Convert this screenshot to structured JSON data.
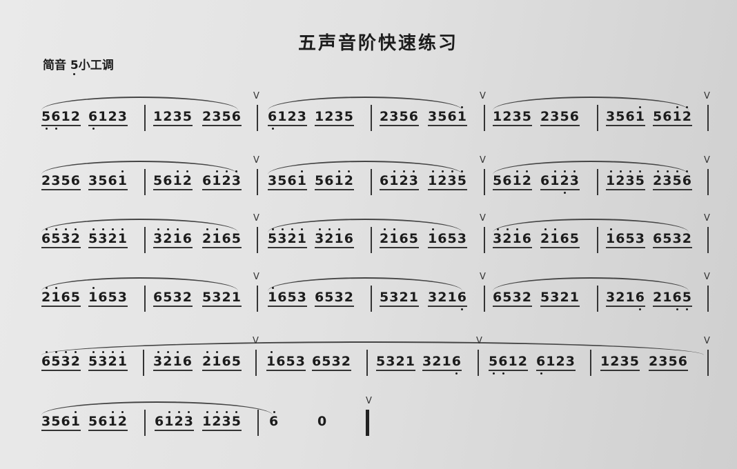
{
  "title": "五声音阶快速练习",
  "key_prefix": "简音 ",
  "key_note": "5",
  "key_suffix": "小工调",
  "rows": [
    {
      "measures": [
        [
          "5612",
          "6123"
        ],
        [
          "1235",
          "2356"
        ],
        [
          "6123",
          "1235"
        ],
        [
          "2356",
          "3561"
        ],
        [
          "1235",
          "2356"
        ],
        [
          "3561",
          "5612"
        ]
      ],
      "hi": [
        [
          [],
          []
        ],
        [
          [],
          []
        ],
        [
          [],
          []
        ],
        [
          [],
          [
            3
          ]
        ],
        [
          [],
          []
        ],
        [
          [
            3
          ],
          [
            2,
            3
          ]
        ]
      ],
      "lo": [
        [
          [
            0,
            1
          ],
          [
            0
          ]
        ],
        [
          [],
          []
        ],
        [
          [
            0
          ],
          []
        ],
        [
          [],
          []
        ],
        [
          [],
          []
        ],
        [
          [],
          []
        ]
      ]
    },
    {
      "measures": [
        [
          "2356",
          "3561"
        ],
        [
          "5612",
          "6123"
        ],
        [
          "3561",
          "5612"
        ],
        [
          "6123",
          "1235"
        ],
        [
          "5612",
          "6123"
        ],
        [
          "1235",
          "2356"
        ]
      ],
      "hi": [
        [
          [],
          [
            3
          ]
        ],
        [
          [
            2,
            3
          ],
          [
            1,
            2,
            3
          ]
        ],
        [
          [
            3
          ],
          [
            2,
            3
          ]
        ],
        [
          [
            1,
            2,
            3
          ],
          [
            0,
            1,
            2,
            3
          ]
        ],
        [
          [
            2,
            3
          ],
          [
            1,
            2,
            3
          ]
        ],
        [
          [
            0,
            1,
            2,
            3
          ],
          [
            0,
            1,
            2,
            3
          ]
        ]
      ],
      "lo": [
        [
          [],
          []
        ],
        [
          [],
          []
        ],
        [
          [],
          []
        ],
        [
          [],
          []
        ],
        [
          [],
          [
            2
          ]
        ],
        [
          [],
          []
        ]
      ]
    },
    {
      "measures": [
        [
          "6532",
          "5321"
        ],
        [
          "3216",
          "2165"
        ],
        [
          "5321",
          "3216"
        ],
        [
          "2165",
          "1653"
        ],
        [
          "3216",
          "2165"
        ],
        [
          "1653",
          "6532"
        ]
      ],
      "hi": [
        [
          [
            0,
            1,
            2,
            3
          ],
          [
            0,
            1,
            2,
            3
          ]
        ],
        [
          [
            0,
            1,
            2
          ],
          [
            0,
            1
          ]
        ],
        [
          [
            0,
            1,
            2,
            3
          ],
          [
            0,
            1,
            2
          ]
        ],
        [
          [
            0,
            1
          ],
          [
            0
          ]
        ],
        [
          [
            0,
            1,
            2
          ],
          [
            0,
            1
          ]
        ],
        [
          [
            0
          ],
          []
        ]
      ],
      "lo": [
        [
          [],
          []
        ],
        [
          [],
          []
        ],
        [
          [],
          []
        ],
        [
          [],
          []
        ],
        [
          [],
          []
        ],
        [
          [],
          []
        ]
      ]
    },
    {
      "measures": [
        [
          "2165",
          "1653"
        ],
        [
          "6532",
          "5321"
        ],
        [
          "1653",
          "6532"
        ],
        [
          "5321",
          "3216"
        ],
        [
          "6532",
          "5321"
        ],
        [
          "3216",
          "2165"
        ]
      ],
      "hi": [
        [
          [
            0,
            1
          ],
          [
            0
          ]
        ],
        [
          [],
          []
        ],
        [
          [
            0
          ],
          []
        ],
        [
          [],
          []
        ],
        [
          [],
          []
        ],
        [
          [],
          []
        ]
      ],
      "lo": [
        [
          [],
          []
        ],
        [
          [],
          []
        ],
        [
          [],
          []
        ],
        [
          [],
          [
            3
          ]
        ],
        [
          [],
          []
        ],
        [
          [
            3
          ],
          [
            2,
            3
          ]
        ]
      ]
    },
    {
      "measures": [
        [
          "6532",
          "5321"
        ],
        [
          "3216",
          "2165"
        ],
        [
          "1653",
          "6532"
        ],
        [
          "5321",
          "3216"
        ],
        [
          "5612",
          "6123"
        ],
        [
          "1235",
          "2356"
        ]
      ],
      "hi": [
        [
          [
            0,
            1,
            2,
            3
          ],
          [
            0,
            1,
            2,
            3
          ]
        ],
        [
          [
            0,
            1,
            2
          ],
          [
            0,
            1
          ]
        ],
        [
          [
            0
          ],
          []
        ],
        [
          [],
          []
        ],
        [
          [],
          []
        ],
        [
          [],
          []
        ]
      ],
      "lo": [
        [
          [],
          []
        ],
        [
          [],
          []
        ],
        [
          [],
          []
        ],
        [
          [],
          [
            3
          ]
        ],
        [
          [
            0,
            1
          ],
          [
            0
          ]
        ],
        [
          [],
          []
        ]
      ]
    },
    {
      "measures": [
        [
          "3561",
          "5612"
        ],
        [
          "6123",
          "1235"
        ],
        [
          "6",
          "0"
        ]
      ],
      "hi": [
        [
          [
            3
          ],
          [
            2,
            3
          ]
        ],
        [
          [
            1,
            2,
            3
          ],
          [
            0,
            1,
            2,
            3
          ]
        ],
        [
          [
            0
          ],
          []
        ]
      ],
      "lo": [
        [
          [],
          []
        ],
        [
          [],
          []
        ],
        [
          [],
          []
        ]
      ]
    }
  ],
  "breath_mark": "V"
}
